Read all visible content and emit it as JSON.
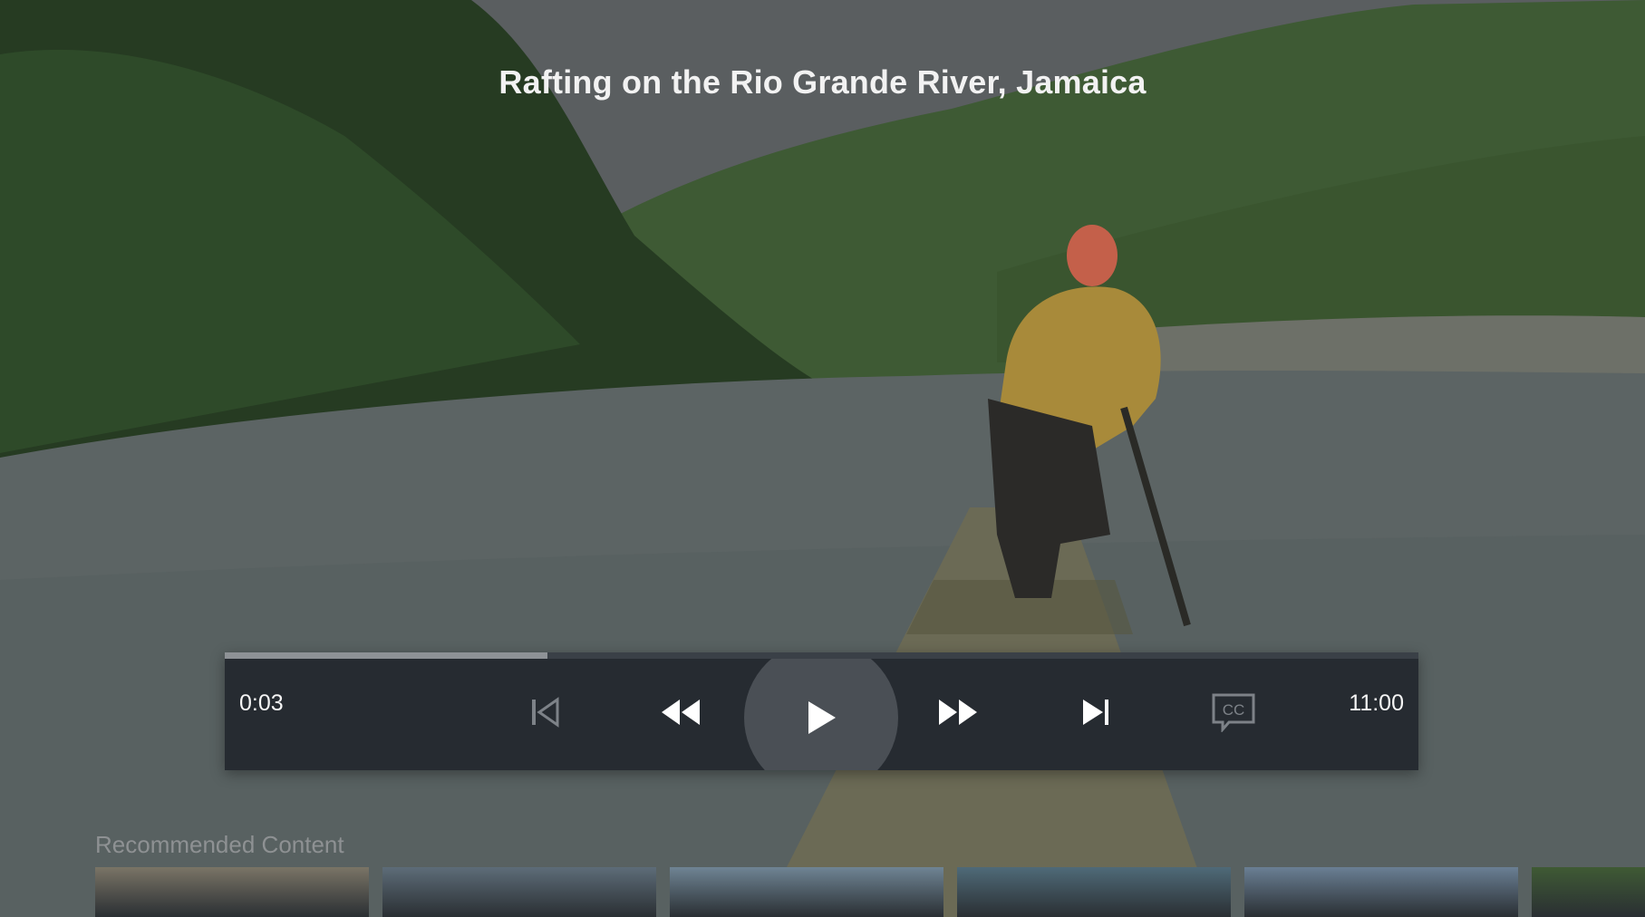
{
  "video": {
    "title": "Rafting on the Rio Grande River, Jamaica"
  },
  "player": {
    "current_time": "0:03",
    "duration": "11:00",
    "progress_fraction": 0.27,
    "state": "paused",
    "controls": [
      {
        "name": "skip-previous",
        "icon": "skip-previous-icon",
        "enabled": false
      },
      {
        "name": "rewind",
        "icon": "rewind-icon",
        "enabled": true
      },
      {
        "name": "play",
        "icon": "play-icon",
        "enabled": true
      },
      {
        "name": "fast-forward",
        "icon": "fast-forward-icon",
        "enabled": true
      },
      {
        "name": "skip-next",
        "icon": "skip-next-icon",
        "enabled": true
      },
      {
        "name": "closed-captions",
        "icon": "cc-icon",
        "label": "CC",
        "enabled": false
      }
    ]
  },
  "recommended": {
    "label": "Recommended Content",
    "items": [
      {
        "icon": "video-thumbnail",
        "color": "#7a7466"
      },
      {
        "icon": "video-thumbnail",
        "color": "#5d6c78"
      },
      {
        "icon": "video-thumbnail",
        "color": "#6f8494"
      },
      {
        "icon": "video-thumbnail",
        "color": "#4f6a78"
      },
      {
        "icon": "video-thumbnail",
        "color": "#6a7f94"
      },
      {
        "icon": "video-thumbnail",
        "color": "#3f5a34"
      }
    ]
  },
  "colors": {
    "controls_bg": "#262b31",
    "play_circle": "#4a4f55",
    "progress_fill": "#8e9296",
    "disabled_icon": "#7d8288",
    "active_icon": "#ffffff"
  }
}
